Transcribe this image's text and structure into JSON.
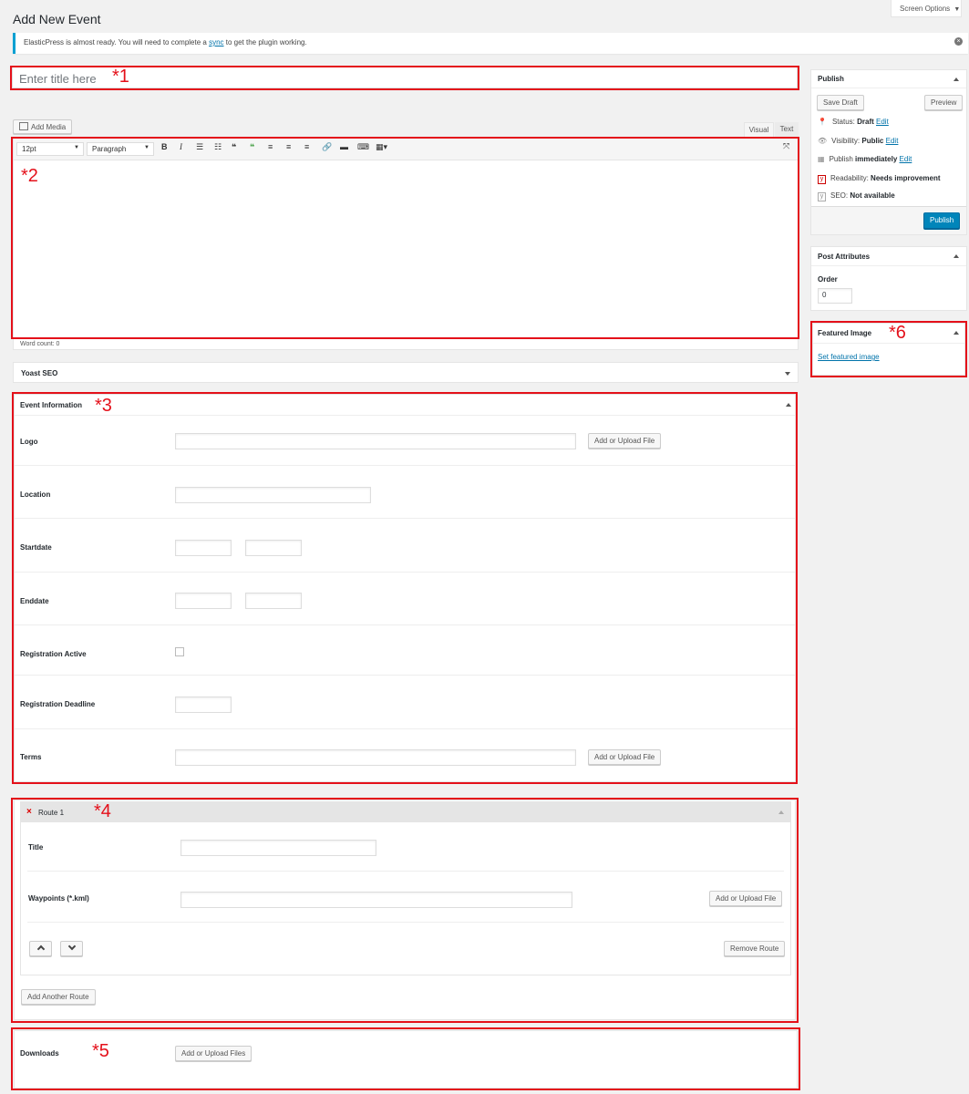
{
  "page": {
    "title": "Add New Event",
    "screen_options": "Screen Options"
  },
  "notice": {
    "text_before": "ElasticPress is almost ready. You will need to complete a ",
    "link": "sync",
    "text_after": " to get the plugin working."
  },
  "title_field": {
    "placeholder": "Enter title here"
  },
  "editor": {
    "add_media": "Add Media",
    "tab_visual": "Visual",
    "tab_text": "Text",
    "font_size": "12pt",
    "format": "Paragraph",
    "word_count": "Word count: 0"
  },
  "yoast": {
    "label": "Yoast SEO"
  },
  "event_info": {
    "title": "Event Information",
    "upload_label": "Add or Upload File",
    "fields": {
      "logo": "Logo",
      "location": "Location",
      "startdate": "Startdate",
      "enddate": "Enddate",
      "registration_active": "Registration Active",
      "registration_deadline": "Registration Deadline",
      "terms": "Terms"
    }
  },
  "route": {
    "title": "Route 1",
    "title_label": "Title",
    "waypoints_label": "Waypoints (*.kml)",
    "upload_label": "Add or Upload File",
    "remove": "Remove Route",
    "add_another": "Add Another Route"
  },
  "downloads": {
    "label": "Downloads",
    "upload_label": "Add or Upload Files"
  },
  "publish": {
    "title": "Publish",
    "save_draft": "Save Draft",
    "preview": "Preview",
    "status_label": "Status:",
    "status_value": "Draft",
    "visibility_label": "Visibility:",
    "visibility_value": "Public",
    "publish_label": "Publish",
    "publish_value": "immediately",
    "readability_label": "Readability:",
    "readability_value": "Needs improvement",
    "seo_label": "SEO:",
    "seo_value": "Not available",
    "edit": "Edit",
    "publish_button": "Publish"
  },
  "post_attributes": {
    "title": "Post Attributes",
    "order_label": "Order",
    "order_value": "0"
  },
  "featured_image": {
    "title": "Featured Image",
    "link": "Set featured image"
  },
  "annotations": [
    "*1",
    "*2",
    "*3",
    "*4",
    "*5",
    "*6"
  ],
  "colors": {
    "annotation": "#e4101a",
    "primary": "#0085ba",
    "link": "#0073aa"
  }
}
